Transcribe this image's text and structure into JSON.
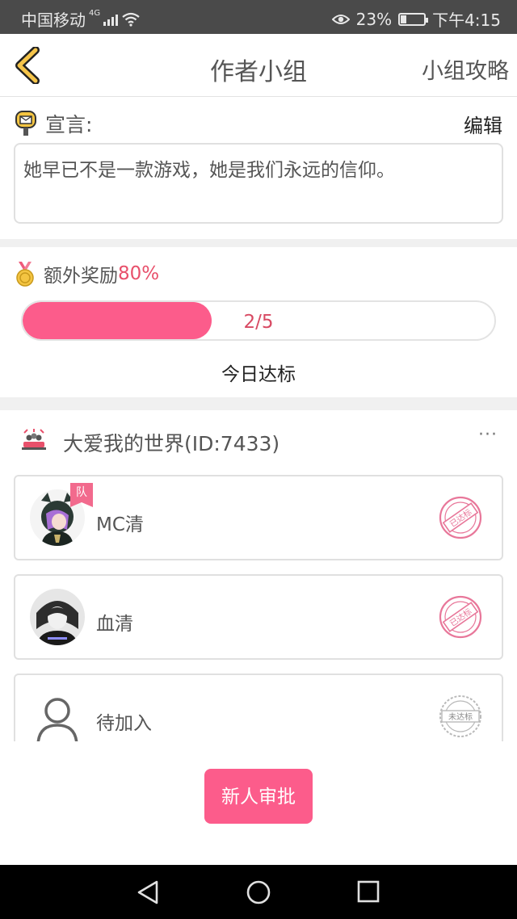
{
  "status_bar": {
    "carrier": "中国移动",
    "network": "4G",
    "battery": "23%",
    "battery_level": 0.23,
    "time": "下午4:15",
    "icons": [
      "signal-icon",
      "wifi-icon",
      "eye-icon",
      "battery-icon"
    ]
  },
  "header": {
    "title": "作者小组",
    "right_link": "小组攻略",
    "back_icon": "chevron-left-icon"
  },
  "declaration": {
    "label": "宣言:",
    "edit_label": "编辑",
    "text": "她早已不是一款游戏，她是我们永远的信仰。"
  },
  "reward": {
    "label": "额外奖励",
    "percent": "80%",
    "progress_text": "2/5",
    "progress_fraction": 0.4,
    "progress_color": "#fc5c8b",
    "status_text": "今日达标"
  },
  "group": {
    "name": "大爱我的世界(ID:7433)",
    "more": "···"
  },
  "members": [
    {
      "name": "MC清",
      "badge": "队",
      "stamp": "已达标"
    },
    {
      "name": "血清",
      "badge": "",
      "stamp": "已达标"
    },
    {
      "name": "待加入",
      "badge": "",
      "stamp": "未达标"
    }
  ],
  "approve_button": "新人审批",
  "colors": {
    "accent": "#fc5c8b",
    "accent_text": "#e8506b",
    "stamp_done": "#e8779a",
    "stamp_pending": "#b9b9b9"
  }
}
